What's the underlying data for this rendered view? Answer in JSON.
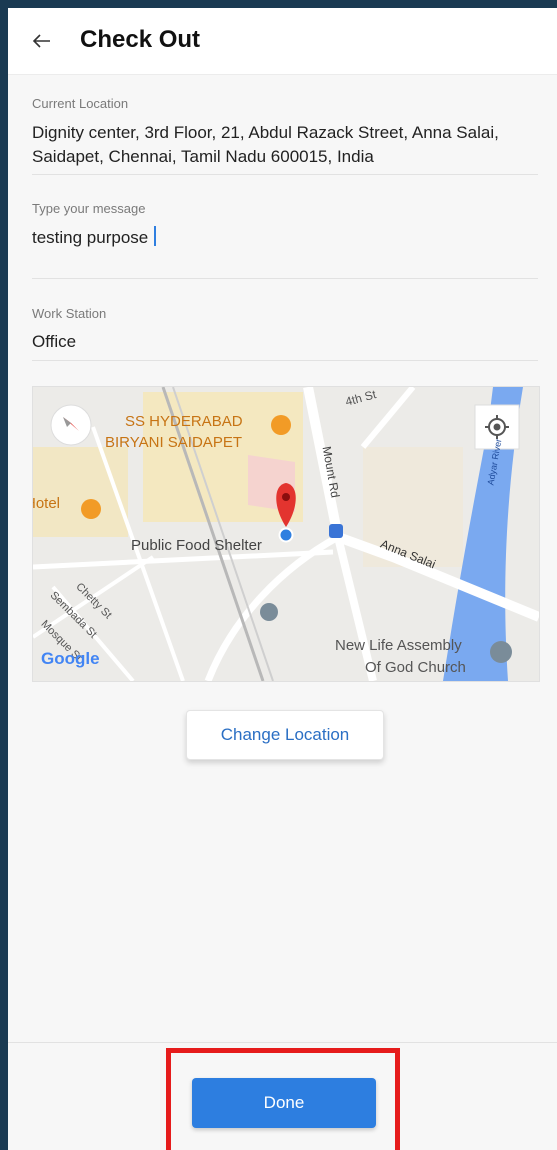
{
  "header": {
    "title": "Check Out",
    "back_icon": "arrow-left-icon"
  },
  "fields": {
    "current_location": {
      "label": "Current Location",
      "line1": "Dignity center, 3rd Floor, 21, Abdul Razack Street, Anna Salai,",
      "line2": "Saidapet, Chennai, Tamil Nadu 600015, India"
    },
    "message": {
      "label": "Type your message",
      "value": "testing purpose"
    },
    "work_station": {
      "label": "Work Station",
      "value": "Office"
    }
  },
  "map": {
    "labels": {
      "biryani1": "SS HYDERABAD",
      "biryani2": "BIRYANI SAIDAPET",
      "hotel": "Hotel",
      "food": "Public Food Shelter",
      "church1": "New Life Assembly",
      "church2": "Of God Church",
      "mount": "Mount Rd",
      "anna": "Anna Salai",
      "fourth": "4th St",
      "chetty": "Chetty St",
      "sembada": "Sembada St",
      "mosque": "Mosque St",
      "adyar": "Adyar River",
      "google": "Google"
    },
    "colors": {
      "river": "#7aa9f0",
      "pin": "#e3342f",
      "road": "#ffffff",
      "poi": "#f29b26"
    }
  },
  "actions": {
    "change_location": "Change Location",
    "done": "Done"
  },
  "colors": {
    "primary": "#2d7ee0",
    "highlight": "#e61c1c"
  }
}
